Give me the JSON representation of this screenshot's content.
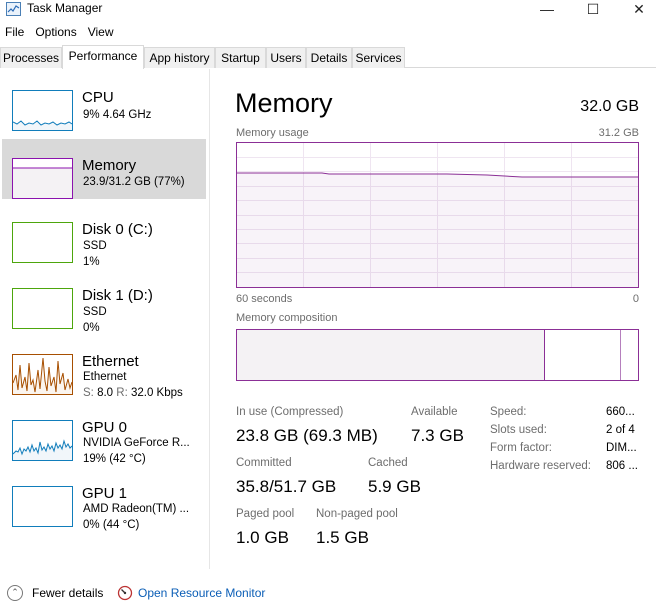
{
  "window": {
    "title": "Task Manager"
  },
  "menu": [
    "File",
    "Options",
    "View"
  ],
  "tabs": [
    "Processes",
    "Performance",
    "App history",
    "Startup",
    "Users",
    "Details",
    "Services"
  ],
  "sidebar": [
    {
      "name": "CPU",
      "line1": "9%  4.64 GHz",
      "line2": "",
      "color": "#117dbb"
    },
    {
      "name": "Memory",
      "line1": "23.9/31.2 GB (77%)",
      "line2": "",
      "color": "#8b12ae"
    },
    {
      "name": "Disk 0 (C:)",
      "line1": "SSD",
      "line2": "1%",
      "color": "#4da60c"
    },
    {
      "name": "Disk 1 (D:)",
      "line1": "SSD",
      "line2": "0%",
      "color": "#4da60c"
    },
    {
      "name": "Ethernet",
      "line1": "Ethernet",
      "line2_send_label": "S:",
      "line2_send": "8.0",
      "line2_recv_label": "R:",
      "line2_recv": "32.0 Kbps",
      "color": "#a74f01"
    },
    {
      "name": "GPU 0",
      "line1": "NVIDIA GeForce R...",
      "line2": "19% (42 °C)",
      "color": "#117dbb"
    },
    {
      "name": "GPU 1",
      "line1": "AMD Radeon(TM) ...",
      "line2": "0% (44 °C)",
      "color": "#117dbb"
    }
  ],
  "main": {
    "title": "Memory",
    "total": "32.0 GB",
    "usage_label": "Memory usage",
    "usage_max": "31.2 GB",
    "time_left": "60 seconds",
    "time_right": "0",
    "composition_label": "Memory composition",
    "stats": {
      "in_use_label": "In use (Compressed)",
      "in_use_value": "23.8 GB (69.3 MB)",
      "available_label": "Available",
      "available_value": "7.3 GB",
      "committed_label": "Committed",
      "committed_value": "35.8/51.7 GB",
      "cached_label": "Cached",
      "cached_value": "5.9 GB",
      "paged_label": "Paged pool",
      "paged_value": "1.0 GB",
      "nonpaged_label": "Non-paged pool",
      "nonpaged_value": "1.5 GB"
    },
    "details": [
      {
        "label": "Speed:",
        "value": "660..."
      },
      {
        "label": "Slots used:",
        "value": "2 of 4"
      },
      {
        "label": "Form factor:",
        "value": "DIM..."
      },
      {
        "label": "Hardware reserved:",
        "value": "806 ..."
      }
    ],
    "usage_fraction": 0.77,
    "accent": "#8b2f96"
  },
  "footer": {
    "fewer_details": "Fewer details",
    "open_resource_monitor": "Open Resource Monitor"
  }
}
